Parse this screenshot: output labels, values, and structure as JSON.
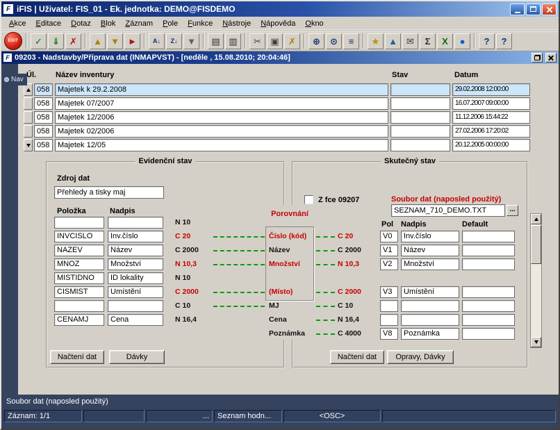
{
  "colors": {
    "face": "#d4d0c8",
    "titlebar_start": "#0a246a",
    "titlebar_end": "#a6caf0",
    "console_bg": "#35435f",
    "selection": "#cde6fa",
    "alert_red": "#c80000",
    "link_green": "#0a9a0a"
  },
  "window": {
    "title": "iFIS | Uživatel:  FIS_01 - Ek. jednotka: DEMO@FISDEMO",
    "icon_letter": "F"
  },
  "menu": {
    "items": [
      "Akce",
      "Editace",
      "Dotaz",
      "Blok",
      "Záznam",
      "Pole",
      "Funkce",
      "Nástroje",
      "Nápověda",
      "Okno"
    ]
  },
  "toolbar": {
    "exit_label": "EXIT",
    "items": [
      {
        "name": "commit",
        "glyph": "✓",
        "color": "#067006"
      },
      {
        "name": "save",
        "glyph": "⇓",
        "color": "#067006"
      },
      {
        "name": "rollback",
        "glyph": "✗",
        "color": "#b01010"
      },
      {
        "sep": true
      },
      {
        "name": "previous-block",
        "glyph": "▲",
        "color": "#b08000"
      },
      {
        "name": "next-block",
        "glyph": "▼",
        "color": "#b08000"
      },
      {
        "name": "clear-form",
        "glyph": "►",
        "color": "#b01010"
      },
      {
        "sep": true
      },
      {
        "name": "sort-asc",
        "glyph": "A↓",
        "color": "#103070"
      },
      {
        "name": "sort-desc",
        "glyph": "Z↓",
        "color": "#103070"
      },
      {
        "name": "filter",
        "glyph": "▼",
        "color": "#606060"
      },
      {
        "sep": true
      },
      {
        "name": "print",
        "glyph": "▤",
        "color": "#303030"
      },
      {
        "name": "print-preview",
        "glyph": "▥",
        "color": "#303030"
      },
      {
        "sep": true
      },
      {
        "name": "cut",
        "glyph": "✂",
        "color": "#404040"
      },
      {
        "name": "copy",
        "glyph": "▣",
        "color": "#404040"
      },
      {
        "name": "erase",
        "glyph": "✗",
        "color": "#b08000"
      },
      {
        "sep": true
      },
      {
        "name": "zoom",
        "glyph": "⊕",
        "color": "#103070"
      },
      {
        "name": "search",
        "glyph": "⊙",
        "color": "#103070"
      },
      {
        "name": "list-values",
        "glyph": "≡",
        "color": "#103070"
      },
      {
        "sep": true
      },
      {
        "name": "settings",
        "glyph": "★",
        "color": "#c09000"
      },
      {
        "name": "chart",
        "glyph": "▲",
        "color": "#2060a0"
      },
      {
        "name": "mail",
        "glyph": "✉",
        "color": "#404040"
      },
      {
        "name": "sum",
        "glyph": "Σ",
        "color": "#303030"
      },
      {
        "name": "excel-export",
        "glyph": "X",
        "color": "#067006"
      },
      {
        "name": "web",
        "glyph": "●",
        "color": "#1060c0"
      },
      {
        "sep": true
      },
      {
        "name": "help",
        "glyph": "?",
        "color": "#103070"
      },
      {
        "name": "context-help",
        "glyph": "?",
        "color": "#103070"
      }
    ]
  },
  "child_window": {
    "title": "09203 - Nadstavby/Příprava dat (INMAPVST) - [neděle , 15.08.2010; 20:04:46]",
    "icon_letter": "F"
  },
  "nav": {
    "label": "Nav"
  },
  "inventory": {
    "columns": [
      "Úl.",
      "Název inventury",
      "Stav",
      "Datum"
    ],
    "rows": [
      {
        "ul": "058",
        "nazev": "Majetek k 29.2.2008",
        "stav": "",
        "datum": "29.02.2008 12:00:00",
        "selected": true
      },
      {
        "ul": "058",
        "nazev": "Majetek 07/2007",
        "stav": "",
        "datum": "16.07.2007 09:00:00",
        "selected": false
      },
      {
        "ul": "058",
        "nazev": "Majetek 12/2006",
        "stav": "",
        "datum": "11.12.2006 15:44:22",
        "selected": false
      },
      {
        "ul": "058",
        "nazev": "Majetek 02/2006",
        "stav": "",
        "datum": "27.02.2006 17:20:02",
        "selected": false
      },
      {
        "ul": "058",
        "nazev": "Majetek 12/05",
        "stav": "",
        "datum": "20.12.2005 00:00:00",
        "selected": false
      }
    ]
  },
  "evidencni": {
    "title": "Evidenční stav",
    "zdroj_label": "Zdroj dat",
    "zdroj_value": "Přehledy a tisky maj",
    "col_polozka": "Položka",
    "col_nadpis": "Nadpis",
    "btn_nacteni": "Načtení dat",
    "btn_davky": "Dávky"
  },
  "porovnani": {
    "title": "Porovnání"
  },
  "skutecny": {
    "title": "Skutečný stav",
    "checkbox_label": "Z fce 09207",
    "checkbox_checked": false,
    "soubor_label": "Soubor dat (naposled použitý)",
    "soubor_value": "SEZNAM_710_DEMO.TXT",
    "browse_label": "...",
    "col_pol": "Pol",
    "col_nadpis": "Nadpis",
    "col_default": "Default",
    "btn_nacteni": "Načtení dat",
    "btn_opravy": "Opravy, Dávky"
  },
  "mapping": {
    "rows": [
      {
        "polozka": "",
        "nadpis": "",
        "ltype": "N 10",
        "lred": false,
        "ldash": false
      },
      {
        "polozka": "INVCISLO",
        "nadpis": "Inv.číslo",
        "ltype": "C 20",
        "lred": true,
        "ldash": true,
        "center": "Číslo (kód)",
        "cred": true,
        "rdash": true,
        "rtype": "C 20",
        "rred": true,
        "pol": "V0",
        "rnadpis": "Inv.číslo",
        "rdefault": ""
      },
      {
        "polozka": "NAZEV",
        "nadpis": "Název",
        "ltype": "C 2000",
        "lred": false,
        "ldash": true,
        "center": "Název",
        "cred": false,
        "rdash": true,
        "rtype": "C 2000",
        "rred": false,
        "pol": "V1",
        "rnadpis": "Název",
        "rdefault": ""
      },
      {
        "polozka": "MNOZ",
        "nadpis": "Množství",
        "ltype": "N 10,3",
        "lred": true,
        "ldash": true,
        "center": "Množství",
        "cred": true,
        "rdash": true,
        "rtype": "N 10,3",
        "rred": true,
        "pol": "V2",
        "rnadpis": "Množství",
        "rdefault": ""
      },
      {
        "polozka": "MISTIDNO",
        "nadpis": "ID lokality",
        "ltype": "N 10",
        "lred": false,
        "ldash": false
      },
      {
        "polozka": "CISMIST",
        "nadpis": "Umístění",
        "ltype": "C 2000",
        "lred": true,
        "ldash": true,
        "center": "(Místo)",
        "cred": true,
        "rdash": true,
        "rtype": "C 2000",
        "rred": true,
        "pol": "V3",
        "rnadpis": "Umístění",
        "rdefault": ""
      },
      {
        "polozka": "",
        "nadpis": "",
        "ltype": "C 10",
        "lred": false,
        "ldash": true,
        "center": "MJ",
        "cred": false,
        "rdash": true,
        "rtype": "C 10",
        "rred": false,
        "pol": "",
        "rnadpis": "",
        "rdefault": ""
      },
      {
        "polozka": "CENAMJ",
        "nadpis": "Cena",
        "ltype": "N 16,4",
        "lred": false,
        "ldash": false,
        "center": "Cena",
        "cred": false,
        "rdash": true,
        "rtype": "N 16,4",
        "rred": false,
        "pol": "",
        "rnadpis": "",
        "rdefault": ""
      },
      {
        "center": "Poznámka",
        "cred": false,
        "rdash": true,
        "rtype": "C 4000",
        "rred": false,
        "pol": "V8",
        "rnadpis": "Poznámka",
        "rdefault": ""
      }
    ]
  },
  "console": {
    "hint": "Soubor dat (naposled použitý)",
    "segments": [
      {
        "name": "record-counter",
        "text": "Záznam: 1/1"
      },
      {
        "name": "status-segment",
        "text": ""
      },
      {
        "name": "ellipsis-indicator",
        "text": "..."
      },
      {
        "name": "list-of-values-indicator",
        "text": "Seznam hodn..."
      },
      {
        "name": "osc-indicator",
        "text": "<OSC>"
      },
      {
        "name": "status-segment",
        "text": ""
      }
    ]
  }
}
